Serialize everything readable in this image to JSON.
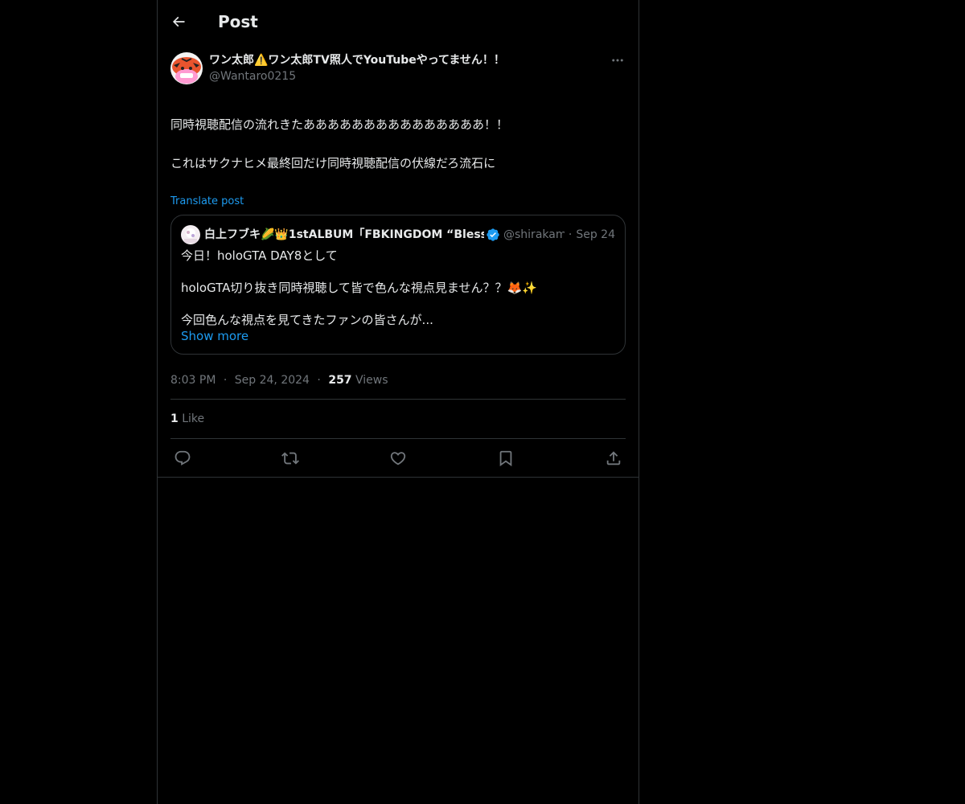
{
  "header": {
    "title": "Post"
  },
  "post": {
    "display_name": "ワン太郎⚠️ワン太郎TV照人でYouTubeやってません！！",
    "handle": "@Wantaro0215",
    "text_line1": "同時視聴配信の流れきたあああああああああああああああ！！",
    "text_line2": "これはサクナヒメ最終回だけ同時視聴配信の伏線だろ流石に",
    "translate_label": "Translate post"
  },
  "quote": {
    "name": "白上フブキ🌽👑1stALBUM「FBKINGDOM “Bless",
    "handle": "@shirakami",
    "date": "Sep 24",
    "line1": "今日！holoGTA DAY8として",
    "line2": "holoGTA切り抜き同時視聴して皆で色んな視点見ません？？🦊✨",
    "line3": "今回色んな視点を見てきたファンの皆さんが...",
    "show_more": "Show more"
  },
  "meta": {
    "time": "8:03 PM",
    "date": "Sep 24, 2024",
    "views_count": "257",
    "views_label": "Views"
  },
  "likes": {
    "count": "1",
    "label": "Like"
  },
  "colors": {
    "background": "#000000",
    "text": "#e7e9ea",
    "muted": "#71767b",
    "accent": "#1d9bf0",
    "border": "#2f3336"
  },
  "icons": [
    "back-arrow-icon",
    "more-icon",
    "verified-icon",
    "reply-icon",
    "repost-icon",
    "like-icon",
    "bookmark-icon",
    "share-icon"
  ]
}
